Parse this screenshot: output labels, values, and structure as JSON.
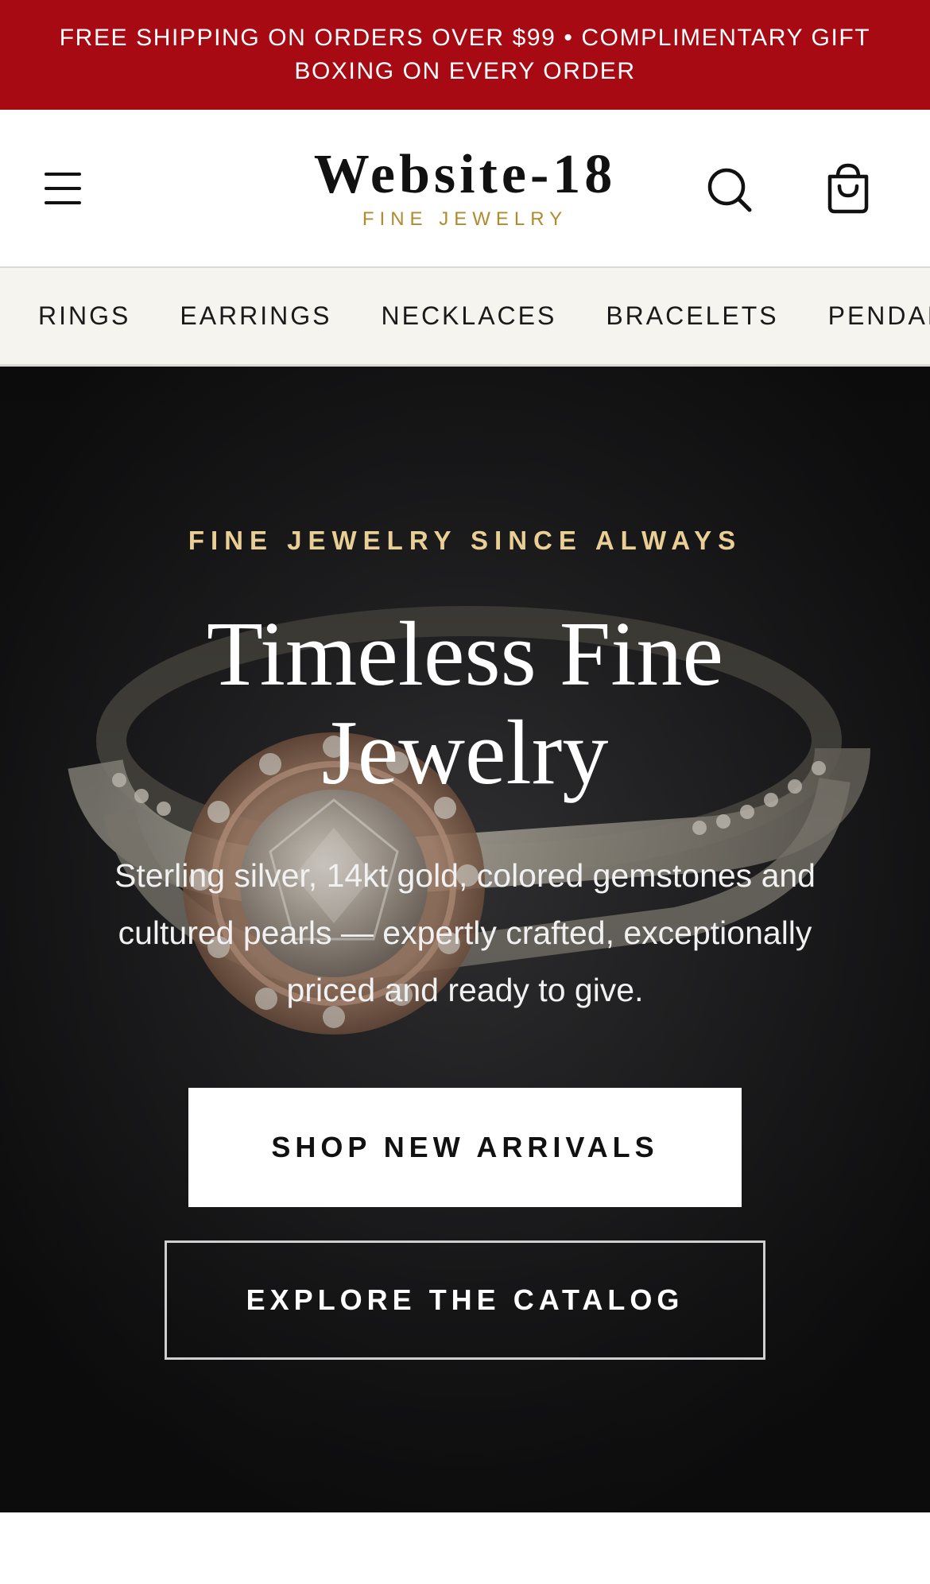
{
  "announcement": {
    "text": "FREE SHIPPING ON ORDERS OVER $99  •  COMPLIMENTARY GIFT BOXING ON EVERY ORDER"
  },
  "header": {
    "brand_name": "Website-18",
    "brand_tagline": "FINE JEWELRY",
    "icons": [
      "menu-icon",
      "search-icon",
      "shopping-bag-icon"
    ]
  },
  "category_nav": {
    "items": [
      "RINGS",
      "EARRINGS",
      "NECKLACES",
      "BRACELETS",
      "PENDANTS"
    ]
  },
  "hero": {
    "eyebrow": "FINE JEWELRY SINCE ALWAYS",
    "title": "Timeless Fine Jewelry",
    "description": "Sterling silver, 14kt gold, colored gemstones and cultured pearls — expertly crafted, exceptionally priced and ready to give.",
    "primary_cta": "SHOP NEW ARRIVALS",
    "secondary_cta": "EXPLORE THE CATALOG"
  },
  "colors": {
    "announcement_bg": "#a70a12",
    "eyebrow_gold": "#e9cf95",
    "tagline_gold": "#b08a2e",
    "nav_bg": "#f6f4ef"
  }
}
